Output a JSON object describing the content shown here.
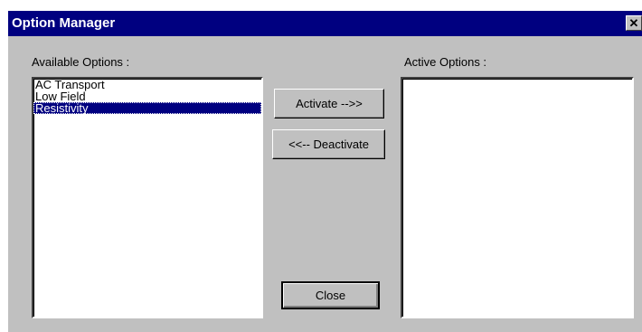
{
  "window": {
    "title": "Option Manager",
    "close_glyph": "✕"
  },
  "available": {
    "label": "Available Options :",
    "items": [
      {
        "label": "AC Transport",
        "selected": false
      },
      {
        "label": "Low Field",
        "selected": false
      },
      {
        "label": "Resistivity",
        "selected": true
      }
    ]
  },
  "active": {
    "label": "Active Options :",
    "items": []
  },
  "buttons": {
    "activate": "Activate -->>",
    "deactivate": "<<-- Deactivate",
    "close": "Close"
  },
  "colors": {
    "titlebar": "#000080",
    "face": "#c0c0c0",
    "selection": "#000080"
  }
}
